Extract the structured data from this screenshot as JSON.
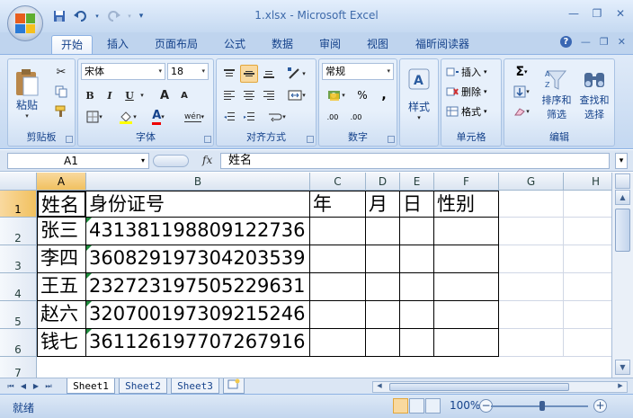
{
  "window": {
    "title": "1.xlsx - Microsoft Excel"
  },
  "quick_access": {
    "save_icon": "save-icon",
    "undo_icon": "undo-icon",
    "redo_icon": "redo-icon",
    "customize": "▾"
  },
  "window_controls": {
    "minimize": "—",
    "restore": "❐",
    "close": "✕"
  },
  "ribbon_tabs": [
    "开始",
    "插入",
    "页面布局",
    "公式",
    "数据",
    "审阅",
    "视图",
    "福昕阅读器"
  ],
  "active_tab": "开始",
  "ribbon_right": {
    "help": "?",
    "min": "—",
    "restore": "❐",
    "close": "✕"
  },
  "groups": {
    "clipboard": {
      "label": "剪贴板",
      "paste": "粘贴"
    },
    "font": {
      "label": "字体",
      "font_name": "宋体",
      "font_size": "18",
      "bold": "B",
      "italic": "I",
      "underline": "U",
      "grow": "A",
      "shrink": "A",
      "font_color": "A",
      "phonetic": "wén"
    },
    "alignment": {
      "label": "对齐方式"
    },
    "number": {
      "label": "数字",
      "format": "常规",
      "percent": "%",
      "comma": ",",
      "inc_decimal": ".00",
      "dec_decimal": ".00"
    },
    "styles": {
      "label": "样式"
    },
    "cells": {
      "label": "单元格",
      "insert": "插入",
      "delete": "删除",
      "format": "格式"
    },
    "editing": {
      "label": "编辑",
      "sum": "Σ",
      "sort_filter_1": "排序和",
      "sort_filter_2": "筛选",
      "find_select_1": "查找和",
      "find_select_2": "选择"
    }
  },
  "formula_bar": {
    "name_box": "A1",
    "fx": "fx",
    "formula": "姓名"
  },
  "columns": [
    "A",
    "B",
    "C",
    "D",
    "E",
    "F",
    "G",
    "H"
  ],
  "rows": [
    "1",
    "2",
    "3",
    "4",
    "5",
    "6",
    "7"
  ],
  "table": {
    "headers": [
      "姓名",
      "身份证号",
      "年",
      "月",
      "日",
      "性别"
    ],
    "rows": [
      [
        "张三",
        "431381198809122736"
      ],
      [
        "李四",
        "360829197304203539"
      ],
      [
        "王五",
        "232723197505229631"
      ],
      [
        "赵六",
        "320700197309215246"
      ],
      [
        "钱七",
        "361126197707267916"
      ]
    ]
  },
  "sheets": [
    "Sheet1",
    "Sheet2",
    "Sheet3"
  ],
  "active_sheet": "Sheet1",
  "status": {
    "ready": "就绪",
    "zoom": "100%",
    "zoom_out": "−",
    "zoom_in": "+"
  },
  "colors": {
    "accent": "#15428b",
    "ribbon_bg": "#c4d8f1",
    "selection": "#f1c15f",
    "text_marker": "#1e8a3c"
  }
}
